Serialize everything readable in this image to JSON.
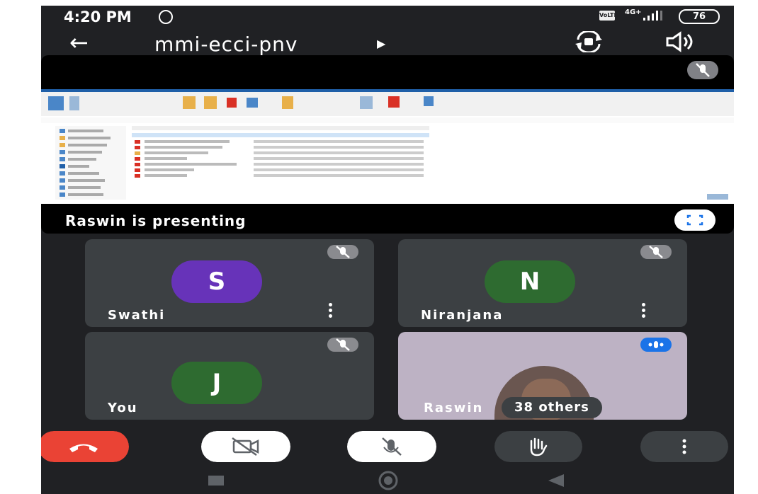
{
  "status_bar": {
    "time": "4:20 PM",
    "network_label": "VoLTE",
    "net_type": "4G+",
    "battery": "76"
  },
  "header": {
    "meeting_code": "mmi-ecci-pnv"
  },
  "presentation": {
    "caption": "Raswin is presenting"
  },
  "participants": [
    {
      "name": "Swathi",
      "initial": "S",
      "avatar_color": "#6733b9"
    },
    {
      "name": "Niranjana",
      "initial": "N",
      "avatar_color": "#2e6b30"
    },
    {
      "name": "You",
      "initial": "J",
      "avatar_color": "#2e6b30"
    }
  ],
  "video_tile": {
    "name": "Raswin",
    "others_label": "38 others"
  },
  "colors": {
    "end_call": "#ea4335",
    "background": "#202124",
    "tile": "#3c4043",
    "speaking_indicator": "#1a73e8"
  },
  "controls": [
    "end-call",
    "camera-off",
    "mic-off",
    "raise-hand",
    "more-options"
  ]
}
